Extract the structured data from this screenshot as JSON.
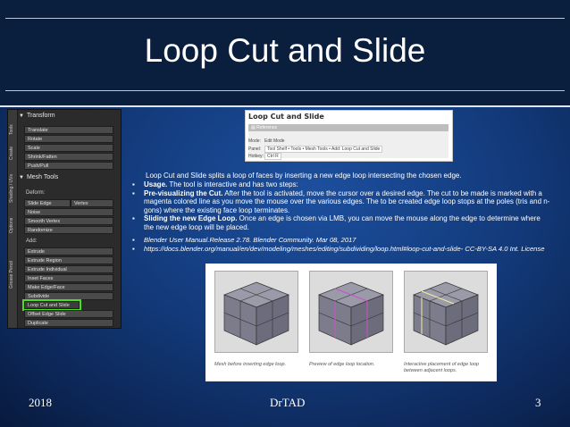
{
  "slide": {
    "title": "Loop Cut and Slide",
    "footer_left": "2018",
    "footer_center": "DrTAD",
    "footer_right": "3"
  },
  "toolshelf": {
    "tabs": [
      "Tools",
      "Create",
      "Shading / UVs",
      "Options",
      "Grease Pencil"
    ],
    "transform_panel": "Transform",
    "transform_buttons": [
      "Translate",
      "Rotate",
      "Scale",
      "Shrink/Fatten",
      "Push/Pull"
    ],
    "mesh_tools_panel": "Mesh Tools",
    "deform_label": "Deform:",
    "deform_row": [
      "Slide Edge",
      "Vertex"
    ],
    "deform_buttons": [
      "Noise",
      "Smooth Vertex",
      "Randomize"
    ],
    "add_label": "Add:",
    "add_buttons": [
      "Extrude",
      "Extrude Region",
      "Extrude Individual",
      "Inset Faces",
      "Make Edge/Face",
      "Subdivide",
      "Loop Cut and Slide",
      "Offset Edge Slide",
      "Duplicate"
    ]
  },
  "reference_card": {
    "title": "Loop Cut and Slide",
    "bar": "Reference",
    "mode_key": "Mode:",
    "mode_val": "Edit Mode",
    "panel_key": "Panel:",
    "panel_val": "Tool Shelf • Tools • Mesh Tools • Add: Loop Cut and Slide",
    "hotkey_key": "Hotkey:",
    "hotkey_val": "Ctrl R"
  },
  "text": {
    "intro": "Loop Cut and Slide splits a loop of faces by inserting a new edge loop intersecting the chosen edge.",
    "b1_bold": "Usage.",
    "b1": " The tool is interactive and has two steps:",
    "b2_bold": "Pre-visualizing the Cut.",
    "b2": " After the tool is activated, move the cursor over a desired edge. The cut to be made is marked with a magenta colored line as you move the mouse over the various edges. The to be created edge loop stops at the poles (tris and n-gons) where the existing face loop terminates.",
    "b3_bold": "Sliding the new Edge Loop.",
    "b3": " Once an edge is chosen via LMB, you can move the mouse along the edge to determine where the new edge loop will be placed.",
    "ref1": "Blender User Manual.Release 2.78. Blender Community. Mar 08, 2017",
    "ref2": "https://docs.blender.org/manual/en/dev/modeling/meshes/editing/subdividing/loop.html#loop-cut-and-slide- CC-BY-SA 4.0 Int. License"
  },
  "figures": {
    "captions": [
      "Mesh before inserting edge loop.",
      "Preview of edge loop location.",
      "Interactive placement of edge loop between adjacent loops."
    ]
  },
  "colors": {
    "highlight": "#4cdc20",
    "title_band": "#0a1e3e",
    "preview_loop": "#d050d0"
  }
}
